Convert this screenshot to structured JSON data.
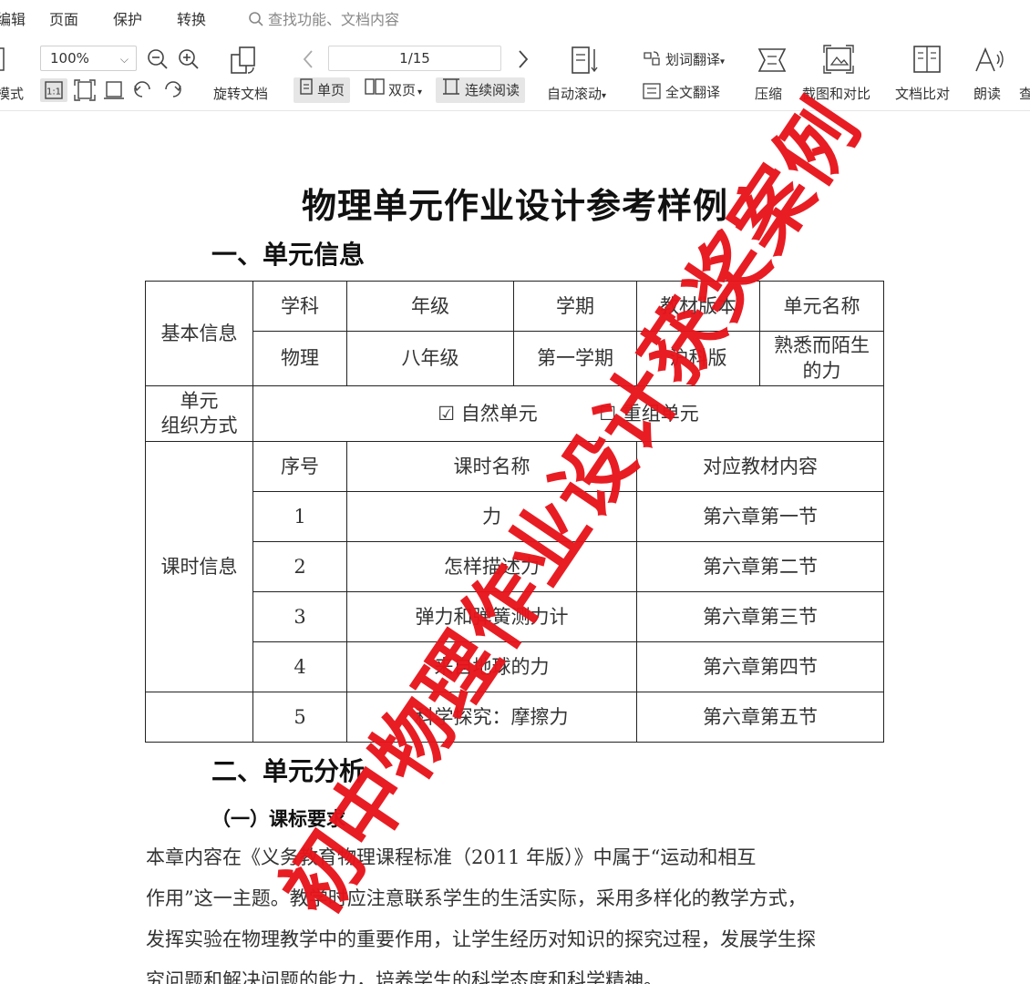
{
  "menu": {
    "edit": "编辑",
    "page": "页面",
    "protect": "保护",
    "convert": "转换",
    "search_placeholder": "查找功能、文档内容"
  },
  "toolbar": {
    "mode_label": "模式",
    "zoom_value": "100%",
    "rotate_doc": "旋转文档",
    "page_indicator": "1/15",
    "single_page": "单页",
    "double_page": "双页",
    "continuous_read": "连续阅读",
    "auto_scroll": "自动滚动",
    "word_translate": "划词翻译",
    "full_translate": "全文翻译",
    "compress": "压缩",
    "screenshot_compare": "截图和对比",
    "text_compare": "文档比对",
    "read_aloud": "朗读",
    "search_cut": "查"
  },
  "document": {
    "title": "物理单元作业设计参考样例",
    "section1": "一、单元信息",
    "table": {
      "basic_info": "基本信息",
      "headers": [
        "学科",
        "年级",
        "学期",
        "教材版本",
        "单元名称"
      ],
      "values": [
        "物理",
        "八年级",
        "第一学期",
        "沪科版",
        "熟悉而陌生的力"
      ],
      "org_label_line1": "单元",
      "org_label_line2": "组织方式",
      "org_option1": "☑ 自然单元",
      "org_option2": "☐ 重组单元",
      "lesson_info": "课时信息",
      "lesson_headers": [
        "序号",
        "课时名称",
        "对应教材内容"
      ],
      "lessons": [
        {
          "no": "1",
          "name": "力",
          "content": "第六章第一节"
        },
        {
          "no": "2",
          "name": "怎样描述力",
          "content": "第六章第二节"
        },
        {
          "no": "3",
          "name": "弹力和弹簧测力计",
          "content": "第六章第三节"
        },
        {
          "no": "4",
          "name": "来自地球的力",
          "content": "第六章第四节"
        },
        {
          "no": "5",
          "name": "科学探究：摩擦力",
          "content": "第六章第五节"
        }
      ]
    },
    "section2": "二、单元分析",
    "subsection1": "（一）课标要求",
    "paragraph_lines": [
      "本章内容在《义务教育物理课程标准（2011 年版）》中属于“运动和相互",
      "作用”这一主题。教学时应注意联系学生的生活实际，采用多样化的教学方式，",
      "发挥实验在物理教学中的重要作用，让学生经历对知识的探究过程，发展学生探",
      "究问题和解决问题的能力，培养学生的科学态度和科学精神。"
    ]
  },
  "watermark": {
    "text": "初中物理作业设计获奖案例",
    "color": "#e8141c"
  }
}
